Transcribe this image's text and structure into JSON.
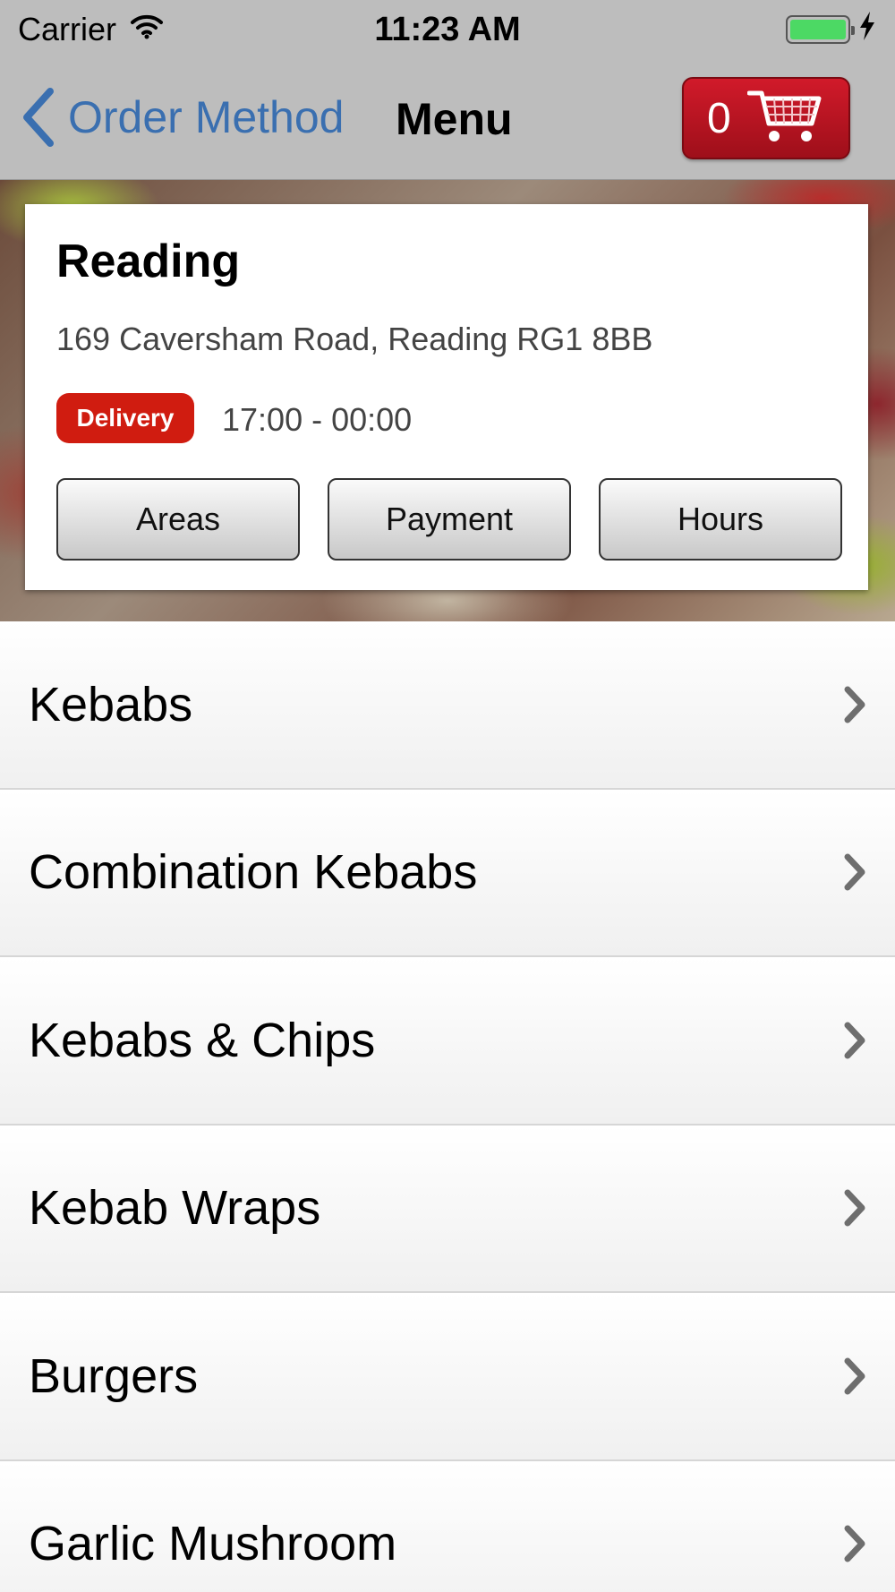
{
  "status_bar": {
    "carrier": "Carrier",
    "time": "11:23 AM",
    "battery_level": 1.0,
    "battery_color": "#4cd964",
    "icons": [
      "wifi-icon",
      "battery-icon",
      "charging-bolt-icon"
    ]
  },
  "nav": {
    "back_label": "Order Method",
    "title": "Menu",
    "cart_count": "0",
    "accent_color": "#3a6fb0",
    "cart_color": "#c01422"
  },
  "store": {
    "name": "Reading",
    "address": "169 Caversham Road, Reading RG1 8BB",
    "delivery_badge": "Delivery",
    "hours": "17:00 - 00:00",
    "buttons": {
      "areas": "Areas",
      "payment": "Payment",
      "hours": "Hours"
    },
    "badge_color": "#d01c10"
  },
  "menu": {
    "items": [
      {
        "label": "Kebabs"
      },
      {
        "label": "Combination Kebabs"
      },
      {
        "label": "Kebabs & Chips"
      },
      {
        "label": "Kebab Wraps"
      },
      {
        "label": "Burgers"
      },
      {
        "label": "Garlic Mushroom"
      }
    ]
  }
}
